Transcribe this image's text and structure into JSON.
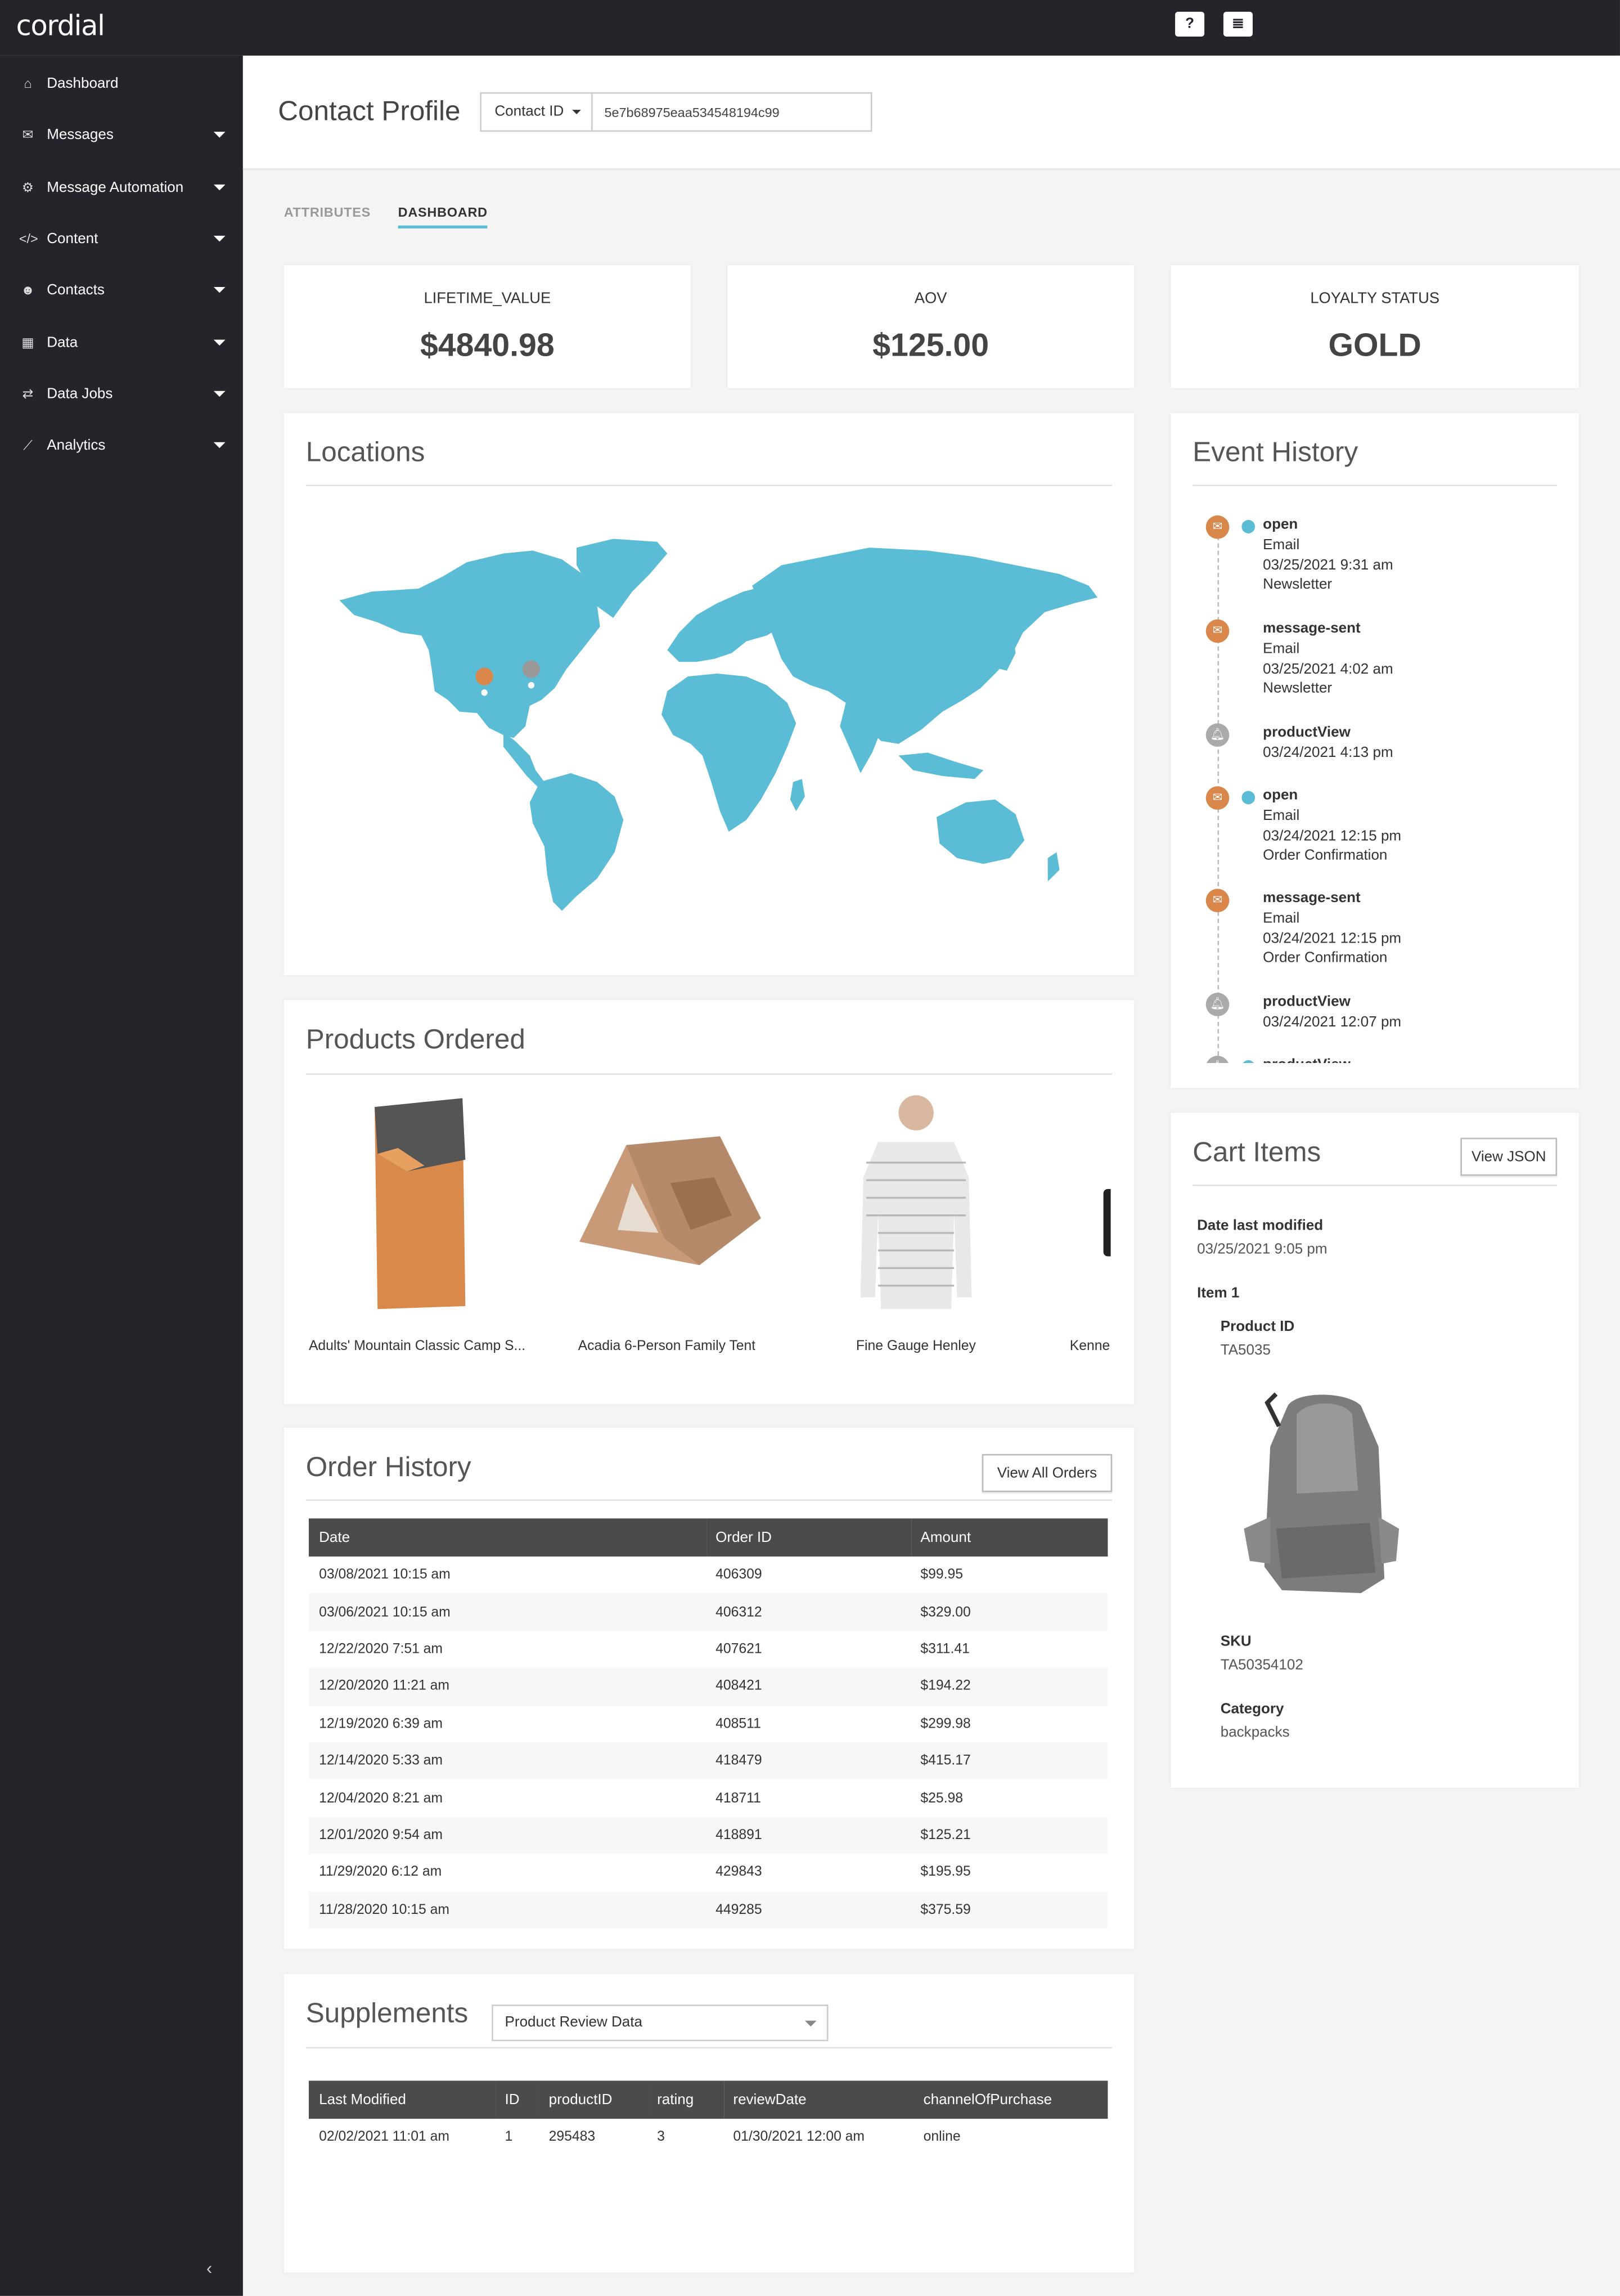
{
  "app": {
    "logo": "cordial"
  },
  "topbar": {
    "help_icon": "question-circle-icon",
    "menu_icon": "list-icon"
  },
  "sidebar": {
    "items": [
      {
        "label": "Dashboard",
        "icon": "home-icon"
      },
      {
        "label": "Messages",
        "icon": "envelope-icon"
      },
      {
        "label": "Message Automation",
        "icon": "cogs-icon"
      },
      {
        "label": "Content",
        "icon": "code-icon"
      },
      {
        "label": "Contacts",
        "icon": "users-icon"
      },
      {
        "label": "Data",
        "icon": "table-icon"
      },
      {
        "label": "Data Jobs",
        "icon": "exchange-icon"
      },
      {
        "label": "Analytics",
        "icon": "line-chart-icon"
      }
    ],
    "collapse_glyph": "‹"
  },
  "header": {
    "title": "Contact Profile",
    "id_selector": "Contact ID",
    "id_value": "5e7b68975eaa534548194c99"
  },
  "tabs": [
    {
      "label": "ATTRIBUTES",
      "active": false
    },
    {
      "label": "DASHBOARD",
      "active": true
    }
  ],
  "kpis": [
    {
      "label": "LIFETIME_VALUE",
      "value": "$4840.98"
    },
    {
      "label": "AOV",
      "value": "$125.00"
    },
    {
      "label": "LOYALTY STATUS",
      "value": "GOLD"
    }
  ],
  "locations": {
    "title": "Locations",
    "map_color": "#5bbcd6",
    "marker_colors": [
      "#d9874a",
      "#999999"
    ]
  },
  "events": {
    "title": "Event History",
    "items": [
      {
        "type": "email",
        "name": "open",
        "lines": [
          "Email",
          "03/25/2021 9:31 am",
          "Newsletter"
        ],
        "pin": true
      },
      {
        "type": "email",
        "name": "message-sent",
        "lines": [
          "Email",
          "03/25/2021 4:02 am",
          "Newsletter"
        ],
        "pin": false
      },
      {
        "type": "bell",
        "name": "productView",
        "lines": [
          "03/24/2021 4:13 pm"
        ],
        "pin": false
      },
      {
        "type": "email",
        "name": "open",
        "lines": [
          "Email",
          "03/24/2021 12:15 pm",
          "Order Confirmation"
        ],
        "pin": true
      },
      {
        "type": "email",
        "name": "message-sent",
        "lines": [
          "Email",
          "03/24/2021 12:15 pm",
          "Order Confirmation"
        ],
        "pin": false
      },
      {
        "type": "bell",
        "name": "productView",
        "lines": [
          "03/24/2021 12:07 pm"
        ],
        "pin": false
      },
      {
        "type": "bell",
        "name": "productView",
        "lines": [],
        "pin": true
      }
    ]
  },
  "products": {
    "title": "Products Ordered",
    "items": [
      {
        "name": "Adults' Mountain Classic Camp S..."
      },
      {
        "name": "Acadia 6-Person Family Tent"
      },
      {
        "name": "Fine Gauge Henley"
      },
      {
        "name": "Kenne"
      }
    ]
  },
  "orders": {
    "title": "Order History",
    "view_all": "View All Orders",
    "columns": [
      "Date",
      "Order ID",
      "Amount"
    ],
    "rows": [
      [
        "03/08/2021 10:15 am",
        "406309",
        "$99.95"
      ],
      [
        "03/06/2021 10:15 am",
        "406312",
        "$329.00"
      ],
      [
        "12/22/2020 7:51 am",
        "407621",
        "$311.41"
      ],
      [
        "12/20/2020 11:21 am",
        "408421",
        "$194.22"
      ],
      [
        "12/19/2020 6:39 am",
        "408511",
        "$299.98"
      ],
      [
        "12/14/2020 5:33 am",
        "418479",
        "$415.17"
      ],
      [
        "12/04/2020 8:21 am",
        "418711",
        "$25.98"
      ],
      [
        "12/01/2020 9:54 am",
        "418891",
        "$125.21"
      ],
      [
        "11/29/2020 6:12 am",
        "429843",
        "$195.95"
      ],
      [
        "11/28/2020 10:15 am",
        "449285",
        "$375.59"
      ]
    ]
  },
  "supplements": {
    "title": "Supplements",
    "selected": "Product Review Data",
    "columns": [
      "Last Modified",
      "ID",
      "productID",
      "rating",
      "reviewDate",
      "channelOfPurchase"
    ],
    "rows": [
      [
        "02/02/2021 11:01 am",
        "1",
        "295483",
        "3",
        "01/30/2021 12:00 am",
        "online"
      ]
    ]
  },
  "cart": {
    "title": "Cart Items",
    "view_json": "View JSON",
    "date_label": "Date last modified",
    "date_value": "03/25/2021 9:05 pm",
    "item_label": "Item 1",
    "product_id_label": "Product ID",
    "product_id": "TA5035",
    "sku_label": "SKU",
    "sku": "TA50354102",
    "category_label": "Category",
    "category": "backpacks"
  },
  "colors": {
    "accent": "#5bbcd6",
    "sidebar": "#23252a",
    "email_event": "#d9874a",
    "view_event": "#aaaaaa"
  }
}
